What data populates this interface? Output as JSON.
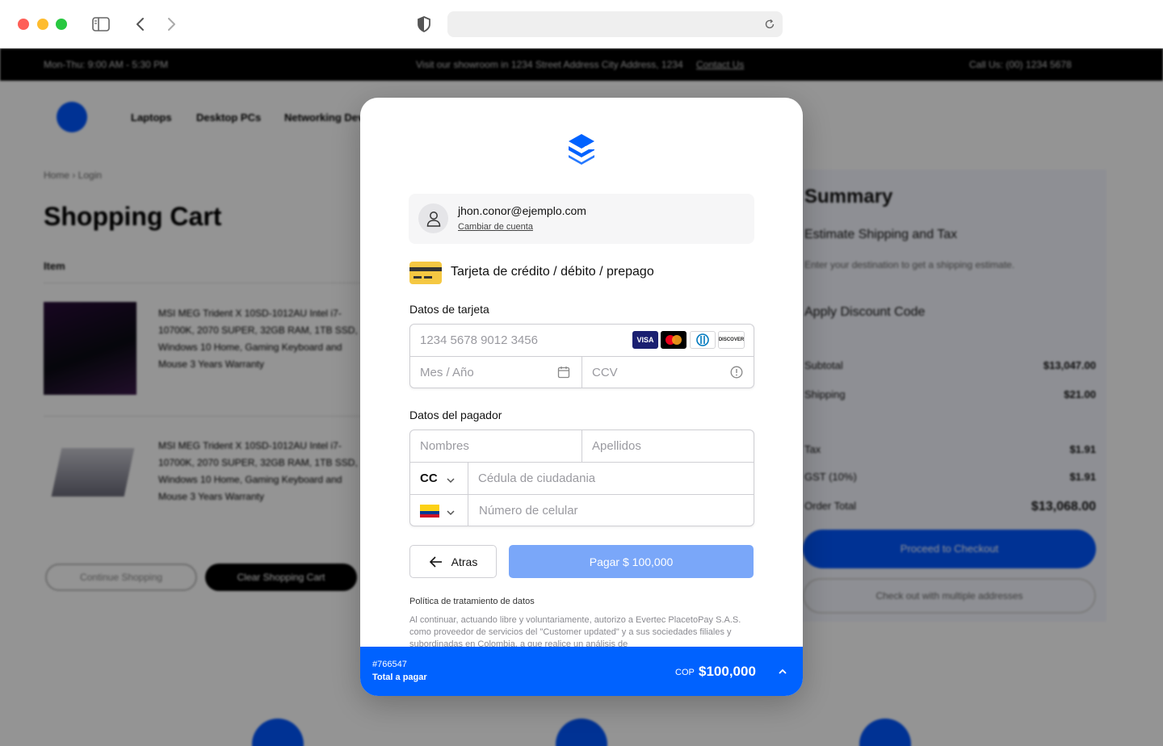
{
  "browser": {
    "url": ""
  },
  "background": {
    "topbar_left": "Mon-Thu: 9:00 AM - 5:30 PM",
    "topbar_center": "Visit our showroom in 1234 Street Address City Address, 1234",
    "topbar_center_link": "Contact Us",
    "topbar_right": "Call Us: (00) 1234 5678",
    "nav_links": [
      "Laptops",
      "Desktop PCs",
      "Networking Devices"
    ],
    "breadcrumb": "Home › Login",
    "title": "Shopping Cart",
    "col_item": "Item",
    "product1": "MSI MEG Trident X 10SD-1012AU Intel i7-10700K, 2070 SUPER, 32GB RAM, 1TB SSD, Windows 10 Home, Gaming Keyboard and Mouse 3 Years Warranty",
    "product2": "MSI MEG Trident X 10SD-1012AU Intel i7-10700K, 2070 SUPER, 32GB RAM, 1TB SSD, Windows 10 Home, Gaming Keyboard and Mouse 3 Years Warranty",
    "btn_continue": "Continue Shopping",
    "btn_clear": "Clear Shopping Cart",
    "summary_title": "Summary",
    "summary_estimate": "Estimate Shipping and Tax",
    "summary_note": "Enter your destination to get a shipping estimate.",
    "summary_discount": "Apply Discount Code",
    "summary_rows": [
      {
        "label": "Subtotal",
        "value": "$13,047.00"
      },
      {
        "label": "Shipping",
        "value": "$21.00"
      },
      {
        "label": "Tax",
        "value": "$1.91"
      },
      {
        "label": "GST (10%)",
        "value": "$1.91"
      },
      {
        "label": "Order Total",
        "value": "$13,068.00"
      }
    ],
    "summary_checkout": "Proceed to Checkout",
    "summary_paypal": "Check out with multiple addresses"
  },
  "modal": {
    "account_email": "jhon.conor@ejemplo.com",
    "account_change": "Cambiar de cuenta",
    "method_label": "Tarjeta de crédito / débito / prepago",
    "card_section": "Datos de tarjeta",
    "card_number_placeholder": "1234 5678 9012 3456",
    "expiry_placeholder": "Mes / Año",
    "cvv_placeholder": "CCV",
    "card_brands": [
      "VISA",
      "mastercard",
      "diners",
      "DISCOVER"
    ],
    "payer_section": "Datos del pagador",
    "first_name_placeholder": "Nombres",
    "last_name_placeholder": "Apellidos",
    "doc_type": "CC",
    "doc_number_placeholder": "Cédula de ciudadania",
    "phone_placeholder": "Número de celular",
    "back_button": "Atras",
    "pay_button": "Pagar $ 100,000",
    "policy_title": "Política de tratamiento de datos",
    "policy_text": "Al continuar, actuando libre y voluntariamente, autorizo a Evertec PlacetoPay S.A.S. como proveedor de servicios del \"Customer updated\" y a sus sociedades filiales y subordinadas en Colombia, a que realice un análisis de",
    "reference": "#766547",
    "total_label": "Total a pagar",
    "currency": "COP",
    "amount": "$100,000"
  },
  "colors": {
    "brand_blue": "#0062ff",
    "pay_button": "#7aa7f9"
  }
}
